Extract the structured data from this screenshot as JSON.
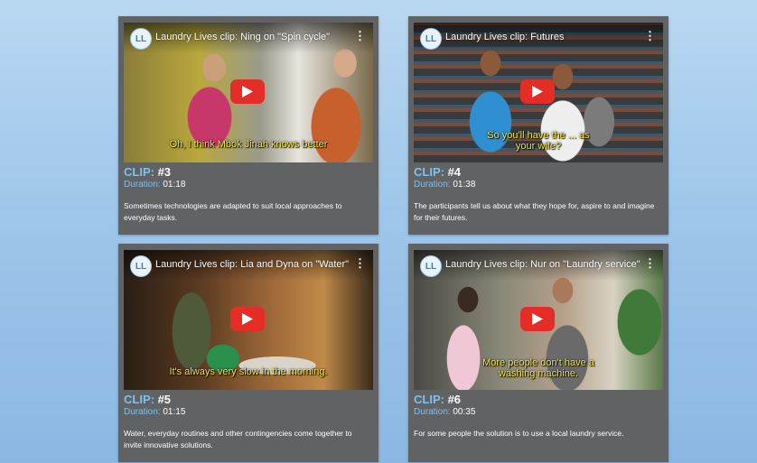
{
  "colors": {
    "clip_label": "#7ec0ee",
    "card_bg": "#616263",
    "play_red": "#e52d27",
    "subtitle": "#f4e64a"
  },
  "clips": [
    {
      "video_title": "Laundry Lives clip: Ning on \"Spin cycle\"",
      "subtitle": "Oh, I think Mbok Jinah knows better",
      "clip_label": "CLIP:",
      "clip_number": "#3",
      "duration_label": "Duration:",
      "duration": "01:18",
      "description": "Sometimes technologies are adapted to suit local approaches to everyday tasks."
    },
    {
      "video_title": "Laundry Lives clip: Futures",
      "subtitle": "So you'll have the ... as your wife?",
      "clip_label": "CLIP:",
      "clip_number": "#4",
      "duration_label": "Duration:",
      "duration": "01:38",
      "description": "The participants tell us about what they hope for, aspire to and imagine for their futures."
    },
    {
      "video_title": "Laundry Lives clip: Lia and Dyna on \"Water\"",
      "subtitle": "It's always very slow in the morning.",
      "clip_label": "CLIP:",
      "clip_number": "#5",
      "duration_label": "Duration:",
      "duration": "01:15",
      "description": "Water, everyday routines and other contingencies come together to invite innovative solutions."
    },
    {
      "video_title": "Laundry Lives clip: Nur on \"Laundry service\"",
      "subtitle": "More people don't have a washing machine.",
      "clip_label": "CLIP:",
      "clip_number": "#6",
      "duration_label": "Duration:",
      "duration": "00:35",
      "description": "For some people the solution is to use a local laundry service."
    }
  ]
}
